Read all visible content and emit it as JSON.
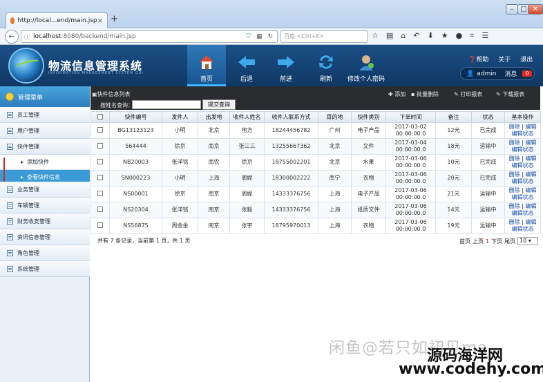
{
  "browser": {
    "tab_title": "http://local...end/main.jsp",
    "url_host": "localhost",
    "url_rest": ":8080/backend/main.jsp",
    "search_placeholder": "百度 <Ctrl+K>"
  },
  "header": {
    "title": "物流信息管理系统",
    "subtitle": "INFORMATION MANAGEMENT SYSTEM GUI",
    "nav": [
      {
        "label": "首页",
        "icon": "home-icon"
      },
      {
        "label": "后退",
        "icon": "arrow-left-icon"
      },
      {
        "label": "前进",
        "icon": "arrow-right-icon"
      },
      {
        "label": "刷新",
        "icon": "refresh-icon"
      },
      {
        "label": "修改个人密码",
        "icon": "user-key-icon"
      }
    ],
    "links": [
      "帮助",
      "关于",
      "退出"
    ],
    "user": "admin",
    "msg_label": "消息",
    "msg_count": "0"
  },
  "sidebar": {
    "title": "管理菜单",
    "items": [
      "员工管理",
      "用户管理",
      "快件管理"
    ],
    "subitems": [
      "添加快件",
      "查看快件信息"
    ],
    "items2": [
      "业务管理",
      "车辆管理",
      "财务收支管理",
      "资讯信息管理",
      "角色管理",
      "系统管理"
    ]
  },
  "content": {
    "list_title": "快件信息列表",
    "search_label": "按姓名查询：",
    "search_button": "提交查询",
    "actions": [
      "添加",
      "批量删除",
      "打印报表",
      "下载报表"
    ],
    "columns": [
      "",
      "快件编号",
      "发件人",
      "出发地",
      "收件人姓名",
      "收件人联系方式",
      "目的地",
      "快件类别",
      "下单时间",
      "备注",
      "状态",
      "基本操作"
    ],
    "rows": [
      [
        "BG13123123",
        "小明",
        "北京",
        "地方",
        "18244456782",
        "广州",
        "电子产品",
        "2017-03-02",
        "00:00:00.0",
        "12元",
        "已完成"
      ],
      [
        "564444",
        "徐京",
        "南京",
        "张三三",
        "13255667362",
        "北京",
        "文件",
        "2017-03-04",
        "00:00:00.0",
        "18元",
        "运输中"
      ],
      [
        "NB20003",
        "张洋铭",
        "南农",
        "徐京",
        "18755002201",
        "北京",
        "水果",
        "2017-03-06",
        "00:00:00.0",
        "10元",
        "已完成"
      ],
      [
        "SN000223",
        "小明",
        "上海",
        "周妮",
        "18300002222",
        "南宁",
        "衣物",
        "2017-03-06",
        "00:00:00.0",
        "20元",
        "已完成"
      ],
      [
        "NS00001",
        "徐京",
        "南京",
        "周妮",
        "14333376756",
        "上海",
        "电子产品",
        "2017-03-06",
        "00:00:00.0",
        "21元",
        "运输中"
      ],
      [
        "NS20304",
        "张洋铭",
        "南京",
        "张毅",
        "14333376756",
        "上海",
        "纸质文件",
        "2017-03-06",
        "00:00:00.0",
        "14元",
        "运输中"
      ],
      [
        "NS56875",
        "周金金",
        "南京",
        "张宇",
        "18795970013",
        "上海",
        "衣物",
        "2017-03-06",
        "00:00:00.0",
        "19元",
        "运输中"
      ]
    ],
    "op_delete": "删除",
    "op_edit": "编辑",
    "op_edit_status": "编辑状态",
    "footer_left": "共有 7 条记录，当前第 1 页，共 1 页",
    "pager": [
      "首页",
      "上页",
      "1",
      "下页",
      "尾页"
    ],
    "page_size": "10"
  },
  "watermarks": [
    "闲鱼@若只如初见ma",
    "源码海洋网",
    "www.codehy.com"
  ]
}
